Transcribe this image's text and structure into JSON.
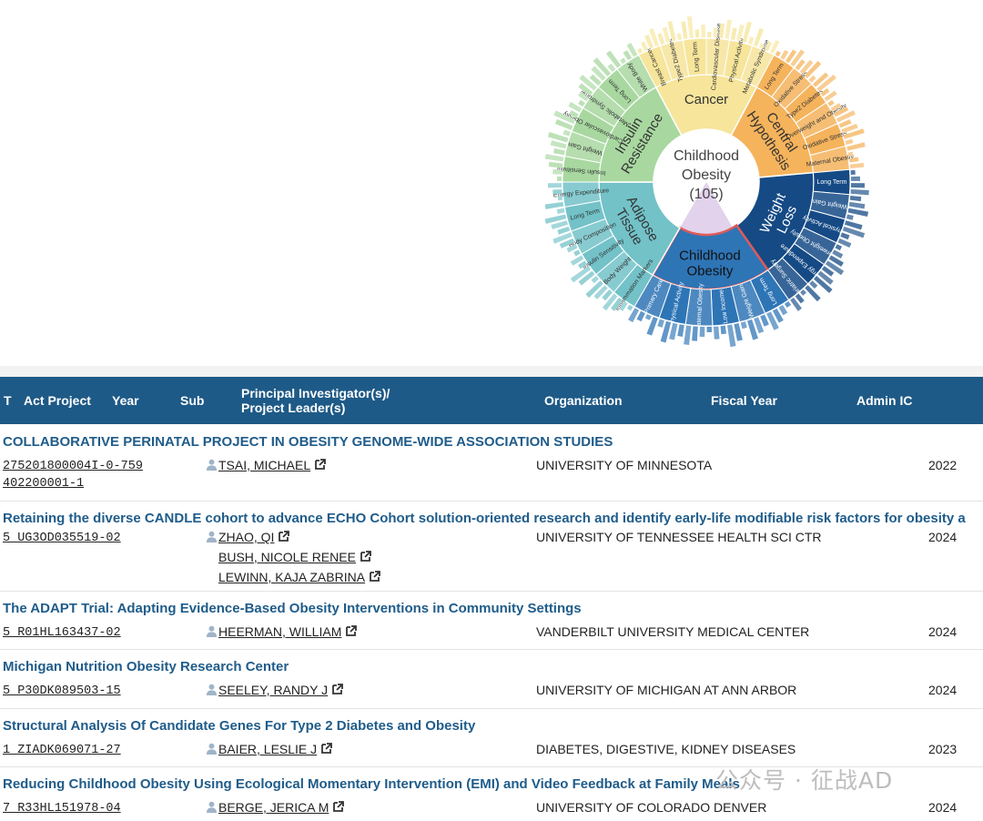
{
  "sunburst": {
    "center_label": [
      "Childhood",
      "Obesity"
    ],
    "center_count": "(105)",
    "inner_segments": [
      {
        "label": [
          "Cancer"
        ],
        "color": "#f6e59a",
        "text_color": "#333333"
      },
      {
        "label": [
          "Central",
          "Hypothesis"
        ],
        "color": "#f5b35c",
        "text_color": "#333333"
      },
      {
        "label": [
          "Weight",
          "Loss"
        ],
        "color": "#154a85",
        "text_color": "#ffffff"
      },
      {
        "label": [
          "Childhood",
          "Obesity"
        ],
        "color": "#2e75b6",
        "text_color": "#111111",
        "highlight": "#e05a5a"
      },
      {
        "label": [
          "Adipose",
          "Tissue"
        ],
        "color": "#72c2c8",
        "text_color": "#333333"
      },
      {
        "label": [
          "Insulin",
          "Resistance"
        ],
        "color": "#a8d8a0",
        "text_color": "#333333"
      }
    ],
    "outer_segments": [
      {
        "group": "Cancer",
        "labels": [
          "Breast Cancer",
          "Type2 Diabetes",
          "Long Term",
          "Cardiovascular Disease",
          "Physical Activity",
          "Metabolic Syndrome"
        ]
      },
      {
        "group": "Central Hypothesis",
        "labels": [
          "Long Term",
          "Oxidative Stress",
          "Type2 Diabetes",
          "Overweight and Obesity",
          "Oxidative Stress",
          "Maternal Obesity"
        ]
      },
      {
        "group": "Weight Loss",
        "labels": [
          "Long Term",
          "Weight Gain",
          "Physical Activity",
          "Overweight Obesity",
          "Energy Expenditure",
          "Bariatric Surgery"
        ]
      },
      {
        "group": "Childhood Obesity",
        "labels": [
          "Long Term",
          "Weight Gain",
          "Low Income",
          "Maternal Obesity",
          "Physical Activity",
          "Primary Care"
        ]
      },
      {
        "group": "Adipose Tissue",
        "labels": [
          "Inflammation Markers",
          "Body Weight",
          "Insulin Sensitivity",
          "Body Composition",
          "Long Term",
          "Energy Expenditure"
        ]
      },
      {
        "group": "Insulin Resistance",
        "labels": [
          "Insulin Sensitivity",
          "Weight Gain",
          "Cardiovascular Obesity",
          "Metabolic Syndrome",
          "Long Term",
          "White Body"
        ]
      }
    ]
  },
  "table": {
    "headers": {
      "type": "T",
      "act": "Act Project",
      "year": "Year",
      "sub": "Sub",
      "pi": "Principal Investigator(s)/ Project Leader(s)",
      "org": "Organization",
      "fy": "Fiscal Year",
      "ic": "Admin IC"
    },
    "rows": [
      {
        "title": "COLLABORATIVE PERINATAL PROJECT IN OBESITY GENOME-WIDE ASSOCIATION STUDIES",
        "project_number": "275201800004I-0-759 402200001-1",
        "pis": [
          "TSAI, MICHAEL"
        ],
        "organization": "UNIVERSITY OF MINNESOTA",
        "fiscal_year": "2022"
      },
      {
        "title": "Retaining the diverse CANDLE cohort to advance ECHO Cohort solution-oriented research and identify early-life modifiable risk factors for obesity a",
        "project_number": "5 UG3OD035519-02",
        "pis": [
          "ZHAO, QI",
          "BUSH, NICOLE RENEE",
          "LEWINN, KAJA ZABRINA"
        ],
        "organization": "UNIVERSITY OF TENNESSEE HEALTH SCI CTR",
        "fiscal_year": "2024"
      },
      {
        "title": "The ADAPT Trial: Adapting Evidence-Based Obesity Interventions in Community Settings",
        "project_number": "5 R01HL163437-02",
        "pis": [
          "HEERMAN, WILLIAM"
        ],
        "organization": "VANDERBILT UNIVERSITY MEDICAL CENTER",
        "fiscal_year": "2024"
      },
      {
        "title": "Michigan Nutrition Obesity Research Center",
        "project_number": "5 P30DK089503-15",
        "pis": [
          "SEELEY, RANDY J"
        ],
        "organization": "UNIVERSITY OF MICHIGAN AT ANN ARBOR",
        "fiscal_year": "2024"
      },
      {
        "title": "Structural Analysis Of Candidate Genes For Type 2 Diabetes and Obesity",
        "project_number": "1 ZIADK069071-27",
        "pis": [
          "BAIER, LESLIE J"
        ],
        "organization": "DIABETES, DIGESTIVE, KIDNEY DISEASES",
        "fiscal_year": "2023"
      },
      {
        "title": "Reducing Childhood Obesity Using Ecological Momentary Intervention (EMI) and Video Feedback at Family Meals",
        "project_number": "7 R33HL151978-04",
        "pis": [
          "BERGE, JERICA M"
        ],
        "organization": "UNIVERSITY OF COLORADO DENVER",
        "fiscal_year": "2024"
      }
    ]
  },
  "watermark": "公众号 · 征战AD",
  "colors": {
    "header_bg": "#1e5a87",
    "title_text": "#1f5c8a",
    "person_icon": "#9fb4c8"
  }
}
